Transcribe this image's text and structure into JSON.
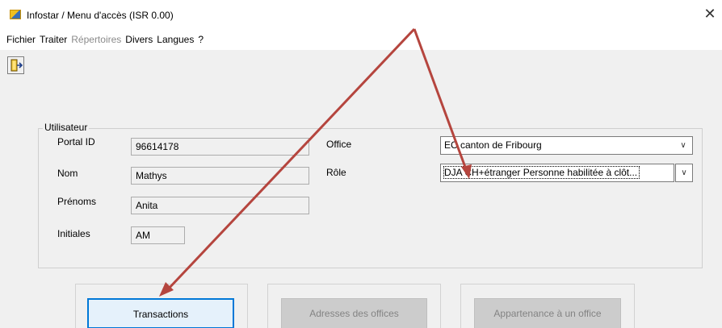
{
  "window": {
    "title": "Infostar / Menu d'accès (ISR 0.00)",
    "close_glyph": "✕"
  },
  "menu": {
    "items": [
      {
        "label": "Fichier",
        "enabled": true
      },
      {
        "label": "Traiter",
        "enabled": true
      },
      {
        "label": "Répertoires",
        "enabled": false
      },
      {
        "label": "Divers",
        "enabled": true
      },
      {
        "label": "Langues",
        "enabled": true
      },
      {
        "label": "?",
        "enabled": true
      }
    ]
  },
  "toolbar": {
    "exit_icon": "exit-door-icon"
  },
  "user_group": {
    "legend": "Utilisateur",
    "portal_id_label": "Portal ID",
    "portal_id_value": "96614178",
    "nom_label": "Nom",
    "nom_value": "Mathys",
    "prenoms_label": "Prénoms",
    "prenoms_value": "Anita",
    "initiales_label": "Initiales",
    "initiales_value": "AM",
    "office_label": "Office",
    "office_value": "EC canton de Fribourg",
    "role_label": "Rôle",
    "role_value": "DJA CH+étranger Personne habilitée à clôt..."
  },
  "actions": {
    "transactions": "Transactions",
    "adresses": "Adresses des offices",
    "appartenance": "Appartenance à un office"
  },
  "annotation": {
    "arrow_color": "#b5453e"
  }
}
